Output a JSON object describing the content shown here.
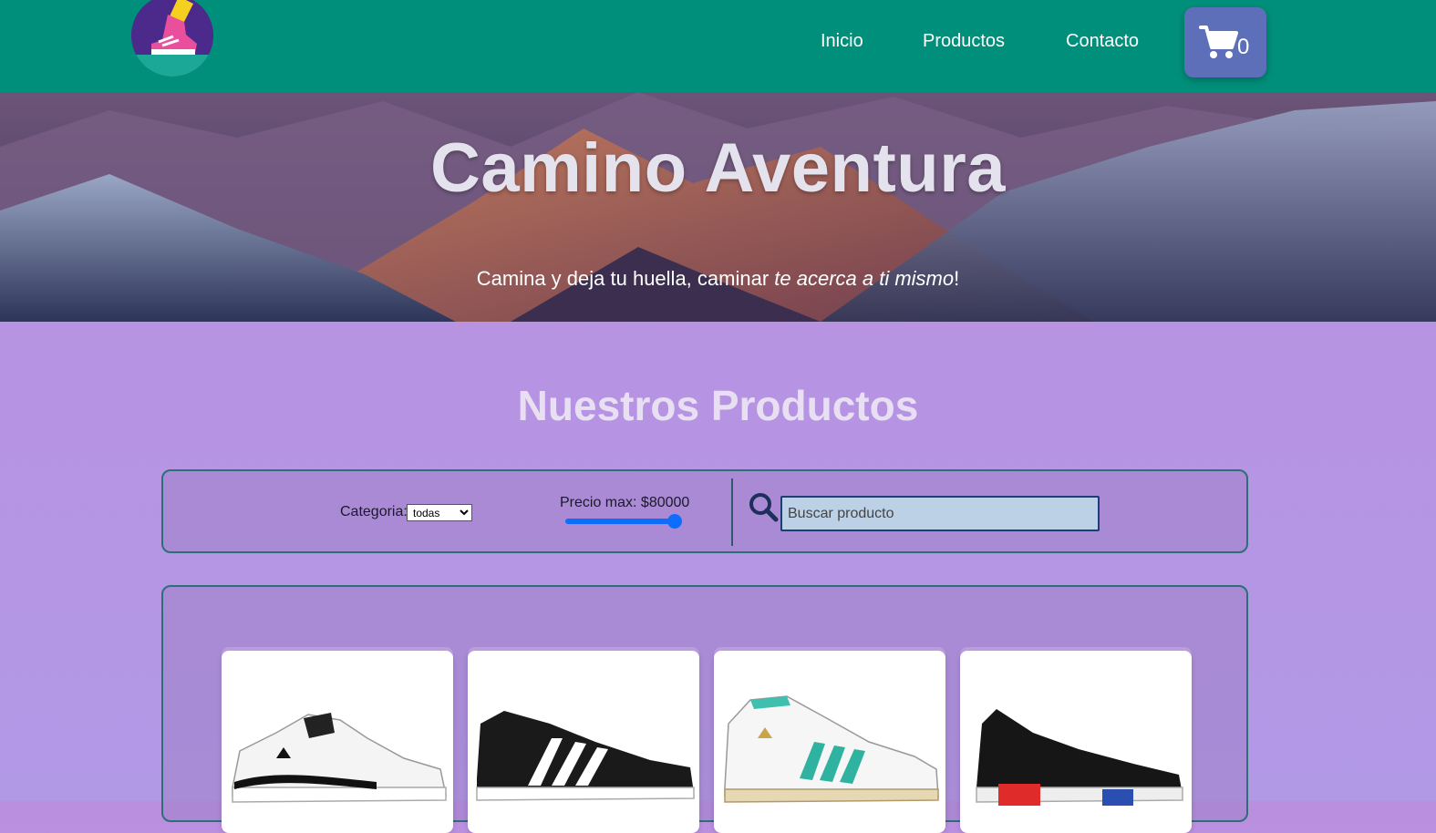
{
  "nav": {
    "links": [
      "Inicio",
      "Productos",
      "Contacto"
    ],
    "cart_count": "0"
  },
  "hero": {
    "title": "Camino Aventura",
    "subtitle_plain": "Camina y deja tu huella, caminar ",
    "subtitle_italic": "te acerca a ti mismo",
    "subtitle_end": "!"
  },
  "section": {
    "title": "Nuestros Productos"
  },
  "filters": {
    "category_label": "Categoria:",
    "category_selected": "todas",
    "price_label": "Precio max: $80000",
    "price_slider_fraction": 0.94,
    "search_placeholder": "Buscar producto"
  },
  "products": [
    {
      "name": "white-black-sneaker",
      "icon": "sneaker-white-black"
    },
    {
      "name": "black-white-stripes-sneaker",
      "icon": "sneaker-black-white"
    },
    {
      "name": "white-teal-stripes-sneaker",
      "icon": "sneaker-white-teal"
    },
    {
      "name": "black-red-sneaker",
      "icon": "sneaker-black-red"
    }
  ],
  "colors": {
    "navbar": "#008f7a",
    "cart_button": "#5d6fb8",
    "page_background": "#bb8fe0",
    "slider": "#0d6efd"
  }
}
